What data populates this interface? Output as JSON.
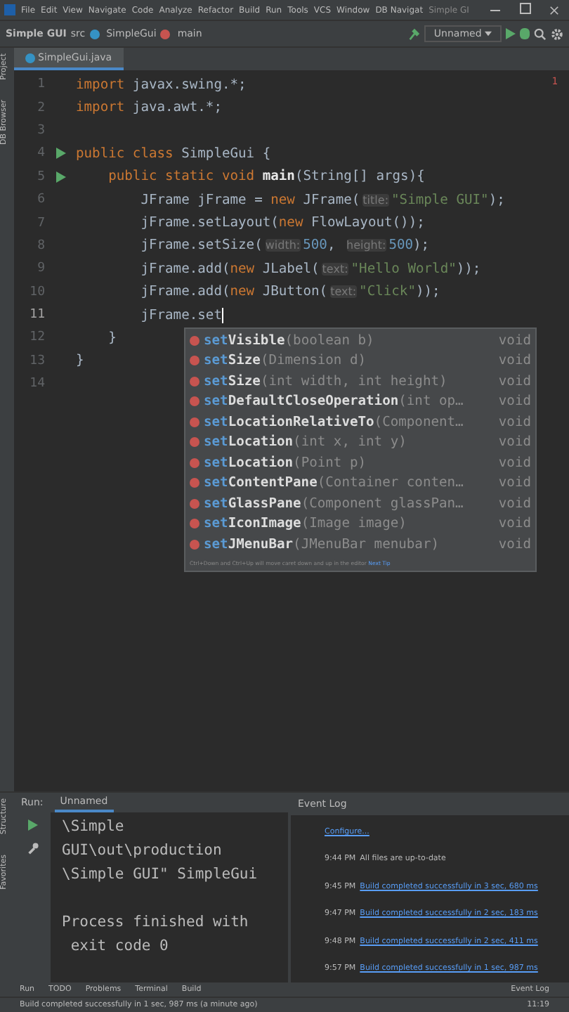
{
  "menu_bar": {
    "items": [
      "File",
      "Edit",
      "View",
      "Navigate",
      "Code",
      "Analyze",
      "Refactor",
      "Build",
      "Run",
      "Tools",
      "VCS",
      "Window",
      "DB Navigat"
    ],
    "title": "Simple GI"
  },
  "nav_bar": {
    "crumbs": [
      {
        "kind": "project",
        "text": "Simple GUI"
      },
      {
        "kind": "folder",
        "text": "src"
      },
      {
        "kind": "class",
        "text": "SimpleGui"
      },
      {
        "kind": "method",
        "text": "main"
      }
    ],
    "run_config": "Unnamed"
  },
  "left_strip": [
    "Project",
    "DB Browser"
  ],
  "editor_tabs": [
    {
      "label": "SimpleGui.java",
      "selected": true
    }
  ],
  "editor": {
    "problems": "1",
    "lines": [
      {
        "number": "1",
        "run": false,
        "current": false,
        "segments": [
          {
            "kind": "kw",
            "text": "import"
          },
          {
            "kind": "plain",
            "text": " javax.swing.*;"
          }
        ]
      },
      {
        "number": "2",
        "run": false,
        "current": false,
        "segments": [
          {
            "kind": "kw",
            "text": "import"
          },
          {
            "kind": "plain",
            "text": " java.awt.*;"
          }
        ]
      },
      {
        "number": "3",
        "run": false,
        "current": false
      },
      {
        "number": "4",
        "run": true,
        "current": false,
        "segments": [
          {
            "kind": "kw",
            "text": "public class"
          },
          {
            "kind": "plain",
            "text": " SimpleGui {"
          }
        ]
      },
      {
        "number": "5",
        "run": true,
        "current": false,
        "segments": [
          {
            "kind": "kw",
            "text": "    public static void "
          },
          {
            "kind": "fn",
            "text": "main"
          },
          {
            "kind": "plain",
            "text": "(String[] args){"
          }
        ]
      },
      {
        "number": "6",
        "run": false,
        "current": false,
        "segments": [
          {
            "kind": "plain",
            "text": "        JFrame jFrame = "
          },
          {
            "kind": "kw",
            "text": "new"
          },
          {
            "kind": "plain",
            "text": " JFrame("
          },
          {
            "kind": "hint",
            "text": "title:"
          },
          {
            "kind": "str",
            "text": "\"Simple GUI\""
          },
          {
            "kind": "plain",
            "text": ");"
          }
        ]
      },
      {
        "number": "7",
        "run": false,
        "current": false,
        "segments": [
          {
            "kind": "plain",
            "text": "        jFrame.setLayout("
          },
          {
            "kind": "kw",
            "text": "new"
          },
          {
            "kind": "plain",
            "text": " FlowLayout());"
          }
        ]
      },
      {
        "number": "8",
        "run": false,
        "current": false,
        "segments": [
          {
            "kind": "plain",
            "text": "        jFrame.setSize("
          },
          {
            "kind": "hint",
            "text": "width:"
          },
          {
            "kind": "num",
            "text": "500"
          },
          {
            "kind": "plain",
            "text": ", "
          },
          {
            "kind": "hint",
            "text": "height:"
          },
          {
            "kind": "num",
            "text": "500"
          },
          {
            "kind": "plain",
            "text": ");"
          }
        ]
      },
      {
        "number": "9",
        "run": false,
        "current": false,
        "segments": [
          {
            "kind": "plain",
            "text": "        jFrame.add("
          },
          {
            "kind": "kw",
            "text": "new"
          },
          {
            "kind": "plain",
            "text": " JLabel("
          },
          {
            "kind": "hint",
            "text": "text:"
          },
          {
            "kind": "str",
            "text": "\"Hello World\""
          },
          {
            "kind": "plain",
            "text": "));"
          }
        ]
      },
      {
        "number": "10",
        "run": false,
        "current": false,
        "segments": [
          {
            "kind": "plain",
            "text": "        jFrame.add("
          },
          {
            "kind": "kw",
            "text": "new"
          },
          {
            "kind": "plain",
            "text": " JButton("
          },
          {
            "kind": "hint",
            "text": "text:"
          },
          {
            "kind": "str",
            "text": "\"Click\""
          },
          {
            "kind": "plain",
            "text": "));"
          }
        ]
      },
      {
        "number": "11",
        "run": false,
        "current": true,
        "segments": [
          {
            "kind": "plain",
            "text": "        jFrame.set"
          }
        ]
      },
      {
        "number": "12",
        "run": false,
        "current": false,
        "segments": [
          {
            "kind": "plain",
            "text": "    }"
          }
        ]
      },
      {
        "number": "13",
        "run": false,
        "current": false,
        "segments": [
          {
            "kind": "plain",
            "text": "}"
          }
        ]
      },
      {
        "number": "14",
        "run": false,
        "current": false
      }
    ]
  },
  "completion": {
    "items": [
      {
        "match": "set",
        "rest": "Visible",
        "params": "(boolean b)",
        "returns": "void"
      },
      {
        "match": "set",
        "rest": "Size",
        "params": "(Dimension d)",
        "returns": "void"
      },
      {
        "match": "set",
        "rest": "Size",
        "params": "(int width, int height)",
        "returns": "void"
      },
      {
        "match": "set",
        "rest": "DefaultCloseOperation",
        "params": "(int op…",
        "returns": "void"
      },
      {
        "match": "set",
        "rest": "LocationRelativeTo",
        "params": "(Component…",
        "returns": "void"
      },
      {
        "match": "set",
        "rest": "Location",
        "params": "(int x, int y)",
        "returns": "void"
      },
      {
        "match": "set",
        "rest": "Location",
        "params": "(Point p)",
        "returns": "void"
      },
      {
        "match": "set",
        "rest": "ContentPane",
        "params": "(Container conten…",
        "returns": "void"
      },
      {
        "match": "set",
        "rest": "GlassPane",
        "params": "(Component glassPan…",
        "returns": "void"
      },
      {
        "match": "set",
        "rest": "IconImage",
        "params": "(Image image)",
        "returns": "void"
      },
      {
        "match": "set",
        "rest": "JMenuBar",
        "params": "(JMenuBar menubar)",
        "returns": "void"
      }
    ],
    "hint": "Ctrl+Down and Ctrl+Up will move caret down and up in the editor",
    "tip_link": "Next Tip"
  },
  "run_panel": {
    "label": "Run:",
    "tab": "Unnamed",
    "output": [
      [
        "\\Simple",
        "GUI\\out\\production",
        "\\Simple GUI\" SimpleGui"
      ],
      [
        "Process finished with",
        " exit code 0"
      ]
    ]
  },
  "event_log": {
    "title": "Event Log",
    "entries": [
      {
        "message": "Configure...",
        "link": true
      },
      {
        "time": "9:44 PM",
        "message": "All files are up-to-date",
        "link": false
      },
      {
        "time": "9:45 PM",
        "message": "Build completed successfully in 3 sec, 680 ms",
        "link": true
      },
      {
        "time": "9:47 PM",
        "message": "Build completed successfully in 2 sec, 183 ms",
        "link": true
      },
      {
        "time": "9:48 PM",
        "message": "Build completed successfully in 2 sec, 411 ms",
        "link": true
      },
      {
        "time": "9:57 PM",
        "message": "Build completed successfully in 1 sec, 987 ms",
        "link": true
      }
    ]
  },
  "side_labels": [
    "Structure",
    "Favorites"
  ],
  "tool_tabs": [
    "Run",
    "TODO",
    "Problems",
    "Terminal",
    "Build"
  ],
  "event_log_button": "Event Log",
  "status_bar": {
    "message": "Build completed successfully in 1 sec, 987 ms (a minute ago)",
    "time": "11:19"
  }
}
